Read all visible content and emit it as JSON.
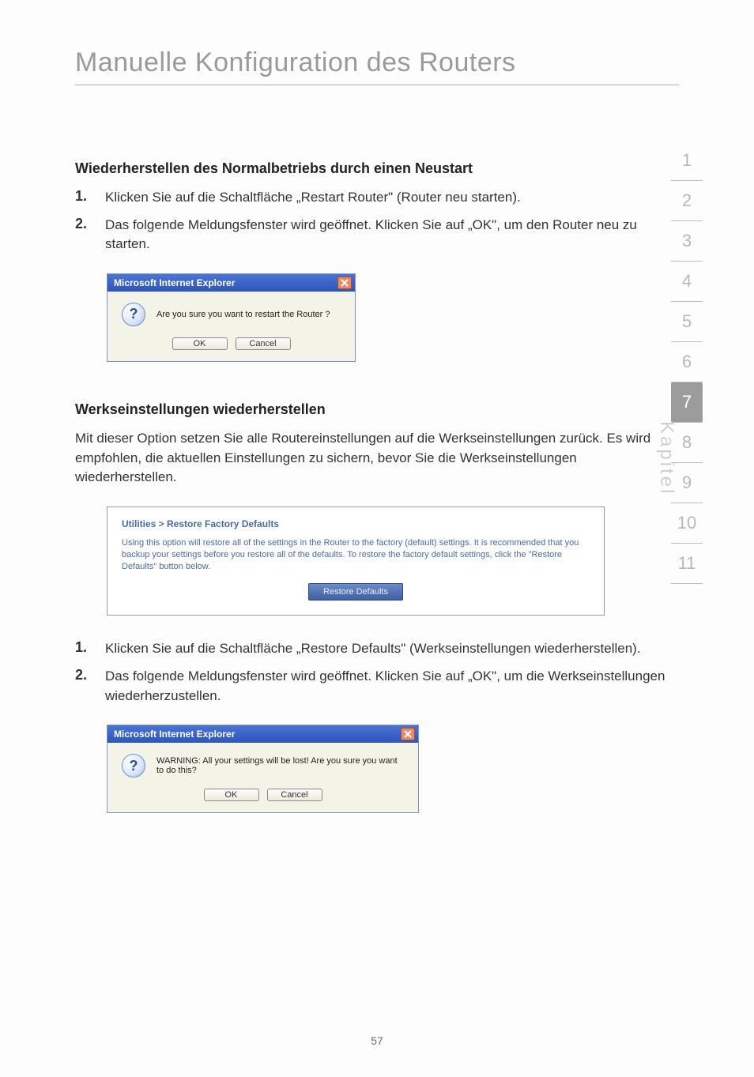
{
  "page_title": "Manuelle Konfiguration des Routers",
  "section1": {
    "heading": "Wiederherstellen des Normalbetriebs durch einen Neustart",
    "step1_num": "1.",
    "step1_txt": "Klicken Sie auf die Schaltfläche „Restart Router\" (Router neu starten).",
    "step2_num": "2.",
    "step2_txt": "Das folgende Meldungsfenster wird geöffnet. Klicken Sie auf „OK\", um den Router neu zu starten."
  },
  "dialog1": {
    "title": "Microsoft Internet Explorer",
    "message": "Are you sure you want to restart the Router ?",
    "ok": "OK",
    "cancel": "Cancel"
  },
  "section2": {
    "heading": "Werkseinstellungen wiederherstellen",
    "intro": "Mit dieser Option setzen Sie alle Routereinstellungen auf die Werkseinstellungen zurück. Es wird empfohlen, die aktuellen Einstellungen zu sichern, bevor Sie die Werkseinstellungen wiederherstellen."
  },
  "util_panel": {
    "breadcrumb": "Utilities > Restore Factory Defaults",
    "desc": "Using this option will restore all of the settings in the Router to the factory (default) settings. It is recommended that you backup your settings before you restore all of the defaults. To restore the factory default settings, click the \"Restore Defaults\" button below.",
    "button": "Restore Defaults"
  },
  "section3": {
    "step1_num": "1.",
    "step1_txt": "Klicken Sie auf die Schaltfläche „Restore Defaults\" (Werkseinstellungen wiederherstellen).",
    "step2_num": "2.",
    "step2_txt": "Das folgende Meldungsfenster wird geöffnet. Klicken Sie auf „OK\", um die Werkseinstellungen wiederherzustellen."
  },
  "dialog2": {
    "title": "Microsoft Internet Explorer",
    "message": "WARNING: All your settings will be lost! Are you sure you want to do this?",
    "ok": "OK",
    "cancel": "Cancel"
  },
  "sidenav": {
    "label": "Kapitel",
    "items": [
      "1",
      "2",
      "3",
      "4",
      "5",
      "6",
      "7",
      "8",
      "9",
      "10",
      "11"
    ],
    "active_index": 6
  },
  "page_number": "57"
}
